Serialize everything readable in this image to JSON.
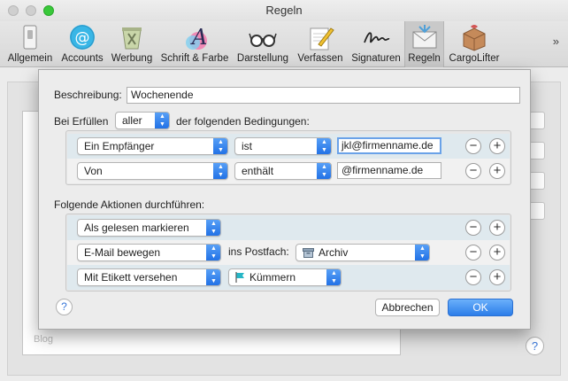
{
  "window": {
    "title": "Regeln"
  },
  "toolbar": {
    "items": [
      {
        "label": "Allgemein",
        "icon": "switch-icon"
      },
      {
        "label": "Accounts",
        "icon": "at-sign-icon"
      },
      {
        "label": "Werbung",
        "icon": "junk-bin-icon"
      },
      {
        "label": "Schrift & Farbe",
        "icon": "font-color-icon"
      },
      {
        "label": "Darstellung",
        "icon": "glasses-icon"
      },
      {
        "label": "Verfassen",
        "icon": "compose-pencil-icon"
      },
      {
        "label": "Signaturen",
        "icon": "signature-icon"
      },
      {
        "label": "Regeln",
        "icon": "rules-envelope-icon",
        "selected": true
      },
      {
        "label": "CargoLifter",
        "icon": "package-icon"
      }
    ],
    "overflow": "»"
  },
  "background": {
    "list_text": "Blog"
  },
  "sheet": {
    "description_label": "Beschreibung:",
    "description_value": "Wochenende",
    "if_label": "Bei Erfüllen",
    "if_select": "aller",
    "if_suffix": "der folgenden Bedingungen:",
    "conditions": [
      {
        "field": "Ein Empfänger",
        "operator": "ist",
        "value": "jkl@firmenname.de"
      },
      {
        "field": "Von",
        "operator": "enthält",
        "value": "@firmenname.de"
      }
    ],
    "actions_label": "Folgende Aktionen durchführen:",
    "actions": [
      {
        "action": "Als gelesen markieren"
      },
      {
        "action": "E-Mail bewegen",
        "target_label": "ins Postfach:",
        "target": "Archiv"
      },
      {
        "action": "Mit Etikett versehen",
        "target": "Kümmern"
      }
    ],
    "remove_symbol": "−",
    "add_symbol": "+",
    "help": "?",
    "cancel_label": "Abbrechen",
    "ok_label": "OK"
  },
  "colors": {
    "accent": "#2b7de9",
    "row_highlight": "#dfe9ee",
    "flag": "#27b6c6",
    "traffic_green": "#39c83a"
  }
}
